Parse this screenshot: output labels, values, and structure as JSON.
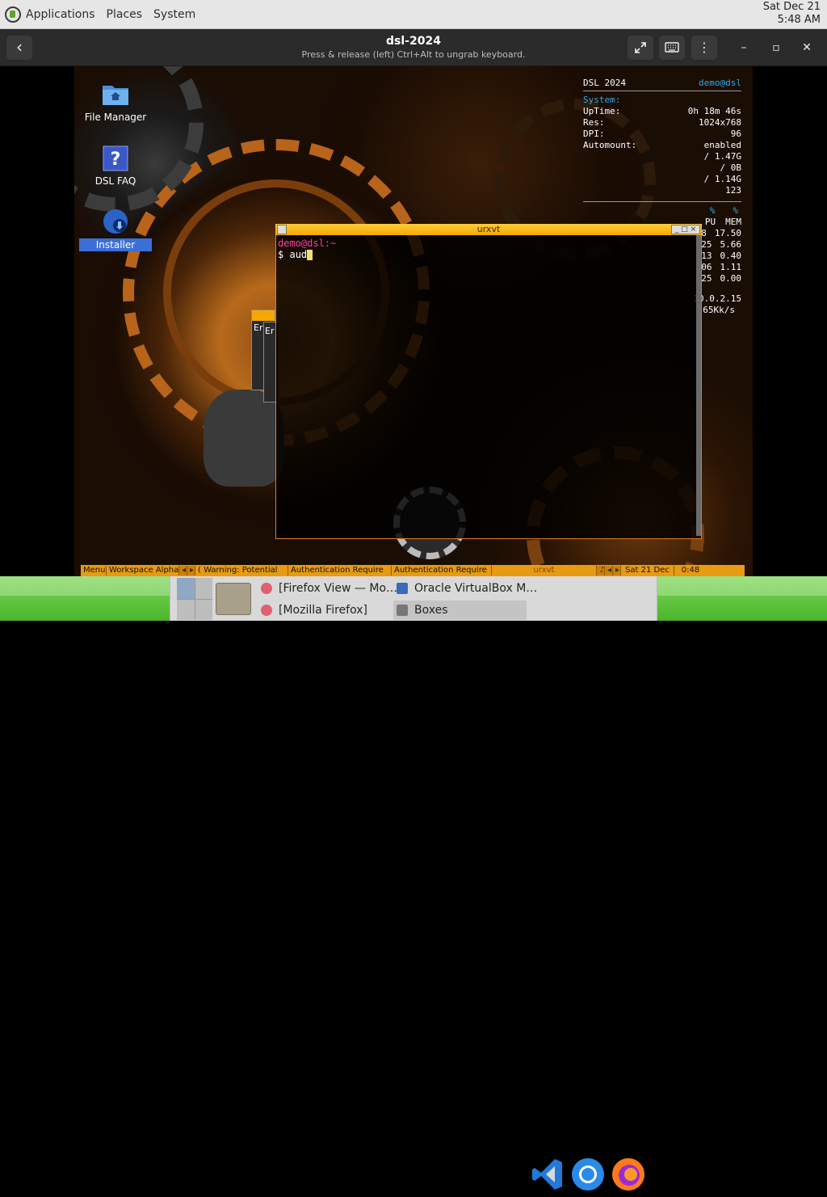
{
  "host_panel": {
    "menus": [
      "Applications",
      "Places",
      "System"
    ],
    "clock_date": "Sat Dec 21",
    "clock_time": "5:48 AM"
  },
  "boxes": {
    "title": "dsl-2024",
    "subtitle": "Press & release (left) Ctrl+Alt to ungrab keyboard.",
    "icons": {
      "back": "back-arrow-icon",
      "fullscreen": "fullscreen-icon",
      "keyboard": "keyboard-icon",
      "menu": "kebab-menu-icon",
      "minimize": "minimize-icon",
      "maximize": "maximize-icon",
      "close": "close-icon"
    }
  },
  "desktop": {
    "icons": [
      {
        "label": "File Manager",
        "icon": "folder-home-icon"
      },
      {
        "label": "DSL FAQ",
        "icon": "help-icon"
      },
      {
        "label": "Installer",
        "icon": "installer-icon"
      }
    ]
  },
  "conky": {
    "title": "DSL 2024",
    "user": "demo@dsl",
    "section": "System:",
    "rows": [
      {
        "k": "UpTime:",
        "v": "0h 18m 46s"
      },
      {
        "k": "Res:",
        "v": "1024x768"
      },
      {
        "k": "DPI:",
        "v": "96"
      },
      {
        "k": "Automount:",
        "v": "enabled"
      },
      {
        "k": "",
        "v": "/ 1.47G"
      },
      {
        "k": "",
        "v": "/ 0B"
      },
      {
        "k": "",
        "v": "/ 1.14G"
      },
      {
        "k": "",
        "v": "123"
      }
    ],
    "proc_header": {
      "pct1": "%",
      "pct2": "%",
      "cpu": "PU",
      "mem": "MEM"
    },
    "procs": [
      {
        "cpu": "88",
        "mem": "17.50"
      },
      {
        "cpu": ".25",
        "mem": "5.66"
      },
      {
        "cpu": ".13",
        "mem": "0.40"
      },
      {
        "cpu": ".06",
        "mem": "1.11"
      },
      {
        "cpu": ".25",
        "mem": "0.00"
      }
    ],
    "net_ip": "10.0.2.15",
    "net_speed": ".65Kk/s"
  },
  "terminal": {
    "title": "urxvt",
    "prompt_user": "demo@dsl:~",
    "prompt_symbol": "$",
    "input": "aud"
  },
  "mini_windows": {
    "label1": "Er",
    "label2": "Er"
  },
  "jwm_tray": {
    "menu": "Menu",
    "workspace": "Workspace Alpha",
    "warning": "( Warning: Potential",
    "auth1": "Authentication Require",
    "auth2": "Authentication Require",
    "task_urxvt": "urxvt",
    "date": "Sat 21 Dec",
    "time": "0:48"
  },
  "host_taskbar": {
    "tasks": [
      {
        "label": "[Firefox View — Mo…",
        "icon": "firefox-small-icon"
      },
      {
        "label": "[Mozilla Firefox]",
        "icon": "firefox-small-icon"
      },
      {
        "label": "Oracle VirtualBox M…",
        "icon": "virtualbox-icon"
      },
      {
        "label": "Boxes",
        "icon": "boxes-icon"
      }
    ],
    "apps": [
      "vscode-icon",
      "chromium-icon",
      "firefox-icon"
    ]
  }
}
